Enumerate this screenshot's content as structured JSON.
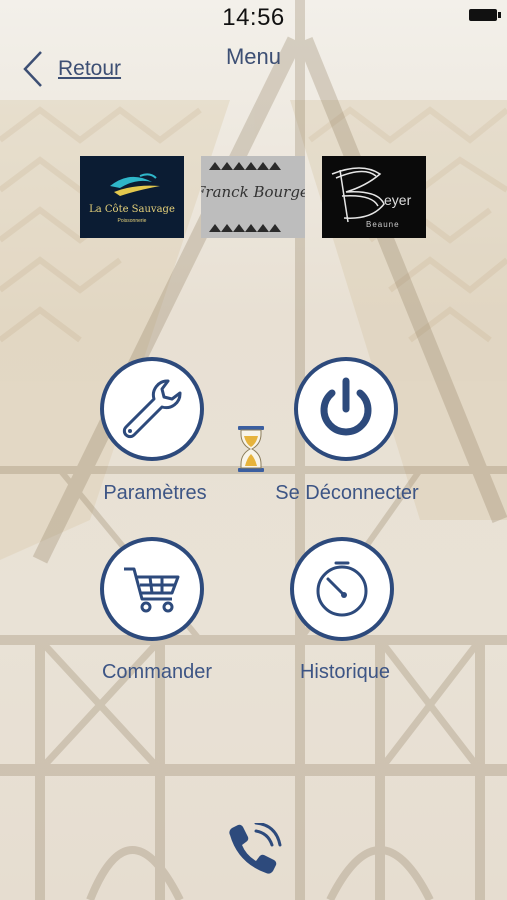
{
  "status_bar": {
    "time": "14:56"
  },
  "header": {
    "title": "Menu",
    "back_label": "Retour"
  },
  "partners": [
    {
      "name": "La Côte Sauvage",
      "subtitle": "Poissonnerie"
    },
    {
      "name": "Franck Bourgeon"
    },
    {
      "name": "eyer",
      "subtitle": "Beaune"
    }
  ],
  "menu": {
    "settings_label": "Paramètres",
    "logout_label": "Se Déconnecter",
    "order_label": "Commander",
    "history_label": "Historique"
  },
  "colors": {
    "accent": "#2d4a7c",
    "label": "#3d5585"
  }
}
